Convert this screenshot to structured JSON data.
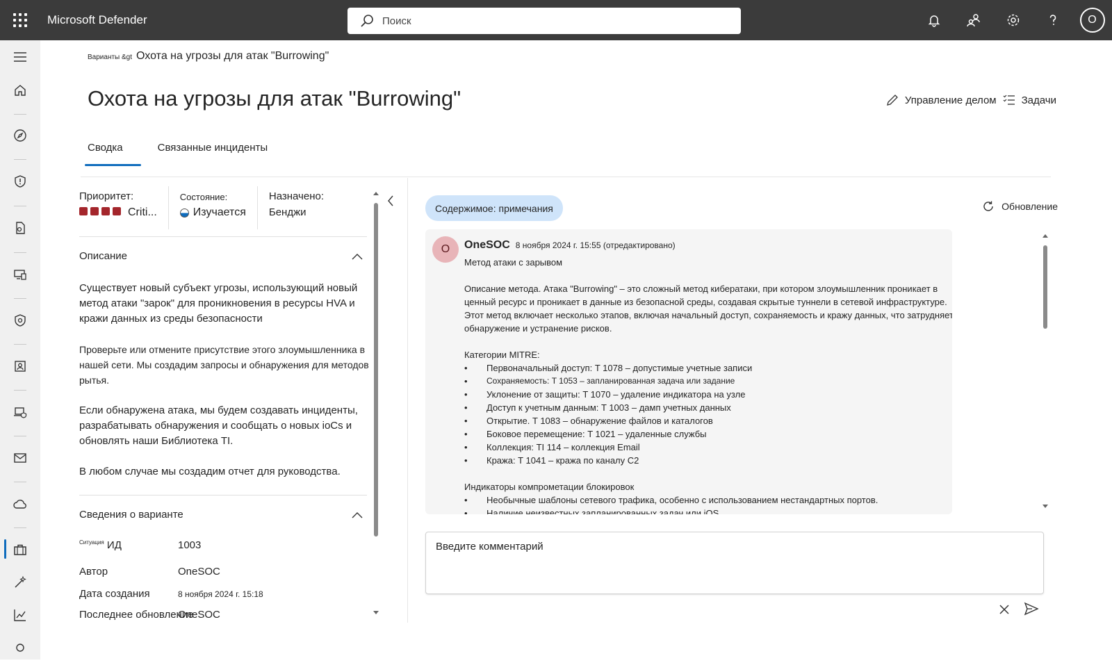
{
  "app": {
    "name": "Microsoft Defender"
  },
  "search": {
    "placeholder": "Поиск"
  },
  "user": {
    "initial": "O"
  },
  "breadcrumb": {
    "root": "Варианты &gt",
    "current": "Охота на угрозы для атак \"Burrowing\""
  },
  "page": {
    "title": "Охота на угрозы для атак \"Burrowing\""
  },
  "actions": {
    "manage": "Управление делом",
    "tasks": "Задачи"
  },
  "tabs": [
    {
      "label": "Сводка"
    },
    {
      "label": "Связанные инциденты"
    }
  ],
  "summary": {
    "priority_label": "Приоритет:",
    "priority_value": "Criti...",
    "priority_color": "#a4262c",
    "state_label": "Состояние:",
    "state_value": "Изучается",
    "assigned_label": "Назначено:",
    "assigned_value": "Бенджи"
  },
  "description": {
    "title": "Описание",
    "paragraphs": [
      "Существует новый субъект угрозы, использующий новый метод атаки \"зарок\" для проникновения в ресурсы HVA и кражи данных из среды безопасности",
      "Проверьте или отмените присутствие этого злоумышленника в нашей сети. Мы создадим запросы и обнаружения для методов рытья.",
      "Если обнаружена атака, мы будем создавать инциденты, разрабатывать обнаружения и сообщать о новых ioCs и обновлять наши Библиотека TI.",
      "В любом случае мы создадим отчет для руководства."
    ]
  },
  "details": {
    "title": "Сведения о варианте",
    "rows": [
      {
        "prefix": "Ситуация",
        "key": "ИД",
        "value": "1003"
      },
      {
        "prefix": "",
        "key": "Автор",
        "value": "OneSOC"
      },
      {
        "prefix": "",
        "key": "Дата создания",
        "value": "8 ноября 2024 г. 15:18"
      },
      {
        "prefix": "",
        "key": "Последнее обновление",
        "value": "OneSOC"
      }
    ]
  },
  "notes": {
    "filter_pill": "Содержимое: примечания",
    "refresh": "Обновление",
    "comment": {
      "avatar": "O",
      "author": "OneSOC",
      "meta": "8 ноября 2024 г. 15:55 (отредактировано)",
      "title": "Метод атаки с зарывом",
      "method": "Описание метода. Атака \"Burrowing\" – это сложный метод кибератаки, при котором злоумышленник проникает в ценный ресурс и проникает в данные из безопасной среды, создавая скрытые туннели в сетевой инфраструктуре. Этот метод включает несколько этапов, включая начальный доступ, сохраняемость и кражу данных, что затрудняет обнаружение и устранение рисков.",
      "mitre_title": "Категории MITRE:",
      "mitre": [
        "Первоначальный доступ: T 1078 – допустимые учетные записи",
        "Сохраняемость: T 1053 – запланированная задача или задание",
        "Уклонение от защиты: T 1070 – удаление индикатора на узле",
        "Доступ к учетным данным: T 1003 – дамп учетных данных",
        "Открытие. T 1083 – обнаружение файлов и каталогов",
        "Боковое перемещение: T 1021 – удаленные службы",
        "Коллекция: TI 114 – коллекция Email",
        "Кража: T 1041 – кража по каналу C2"
      ],
      "ioc_title": "Индикаторы компрометации блокировок",
      "ioc": [
        "Необычные шаблоны сетевого трафика, особенно с использованием нестандартных портов.",
        "Наличие неизвестных запланированных задач или iOS"
      ]
    },
    "input_placeholder": "Введите комментарий"
  }
}
